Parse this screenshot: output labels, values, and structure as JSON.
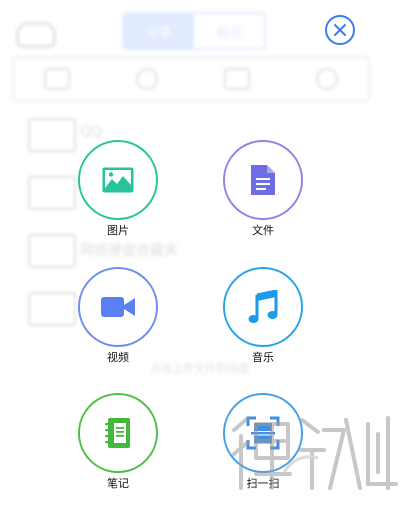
{
  "background": {
    "segmented": [
      "分享",
      "最近"
    ],
    "rows": [
      "QQ",
      "",
      "网络硬盘收藏夹",
      ""
    ],
    "note": "点击上传文件到网盘"
  },
  "upload_menu": {
    "items": [
      {
        "id": "image",
        "label": "图片",
        "icon": "image-icon",
        "ring_color": "#27c49a",
        "icon_color": "#27c49a"
      },
      {
        "id": "file",
        "label": "文件",
        "icon": "document-icon",
        "ring_color": "#8c86e8",
        "icon_color": "#6d6de6"
      },
      {
        "id": "video",
        "label": "视频",
        "icon": "video-camera-icon",
        "ring_color": "#6f8df0",
        "icon_color": "#5b7ff5"
      },
      {
        "id": "music",
        "label": "音乐",
        "icon": "music-note-icon",
        "ring_color": "#2aa3e6",
        "icon_color": "#1e9ae6"
      },
      {
        "id": "note",
        "label": "笔记",
        "icon": "notebook-icon",
        "ring_color": "#4fc043",
        "icon_color": "#43b83a"
      },
      {
        "id": "scan",
        "label": "扫一扫",
        "icon": "scan-icon",
        "ring_color": "#46a0e8",
        "icon_color": "#3f8ee8"
      }
    ]
  },
  "colors": {
    "accent": "#3a7df0"
  }
}
